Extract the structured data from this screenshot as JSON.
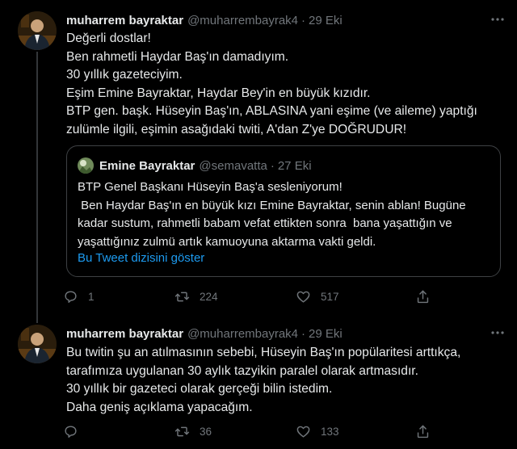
{
  "tweets": [
    {
      "author_name": "muharrem bayraktar",
      "handle": "@muharrembayrak4",
      "dot": "·",
      "date": "29 Eki",
      "lines": [
        "Değerli dostlar!",
        "Ben rahmetli Haydar Baş'ın damadıyım.",
        "30 yıllık gazeteciyim.",
        "Eşim Emine Bayraktar, Haydar Bey'in en büyük kızıdır.",
        "BTP gen. başk. Hüseyin Baş'ın, ABLASINA yani eşime (ve aileme) yaptığı",
        "zulümle ilgili, eşimin  asağıdaki twiti, A'dan Z'ye DOĞRUDUR!"
      ],
      "quote": {
        "author_name": "Emine Bayraktar",
        "handle": "@semavatta",
        "dot": "·",
        "date": "27 Eki",
        "lines": [
          "BTP Genel Başkanı Hüseyin Baş'a sesleniyorum!",
          " Ben Haydar Baş'ın en büyük kızı Emine Bayraktar, senin ablan! Bugüne",
          "kadar sustum, rahmetli babam vefat ettikten sonra  bana yaşattığın ve",
          "yaşattığınız zulmü artık kamuoyuna aktarma vakti geldi."
        ],
        "thread_link": "Bu Tweet dizisini göster"
      },
      "actions": {
        "reply_count": "1",
        "retweet_count": "224",
        "like_count": "517",
        "share_count": ""
      }
    },
    {
      "author_name": "muharrem bayraktar",
      "handle": "@muharrembayrak4",
      "dot": "·",
      "date": "29 Eki",
      "lines": [
        "Bu twitin şu an atılmasının sebebi, Hüseyin Baş'ın popülaritesi arttıkça,",
        "tarafımıza uygulanan 30 aylık tazyikin paralel olarak artmasıdır.",
        "30 yıllık bir gazeteci olarak gerçeği bilin istedim.",
        "Daha geniş açıklama yapacağım."
      ],
      "actions": {
        "reply_count": "",
        "retweet_count": "36",
        "like_count": "133",
        "share_count": ""
      }
    }
  ],
  "icons": {
    "more": "more-dots-icon",
    "reply": "reply-icon",
    "retweet": "retweet-icon",
    "like": "heart-icon",
    "share": "share-icon"
  },
  "colors": {
    "background": "#000000",
    "text": "#e7e9ea",
    "secondary": "#71767b",
    "link": "#1d9bf0",
    "border": "#2f3336"
  }
}
